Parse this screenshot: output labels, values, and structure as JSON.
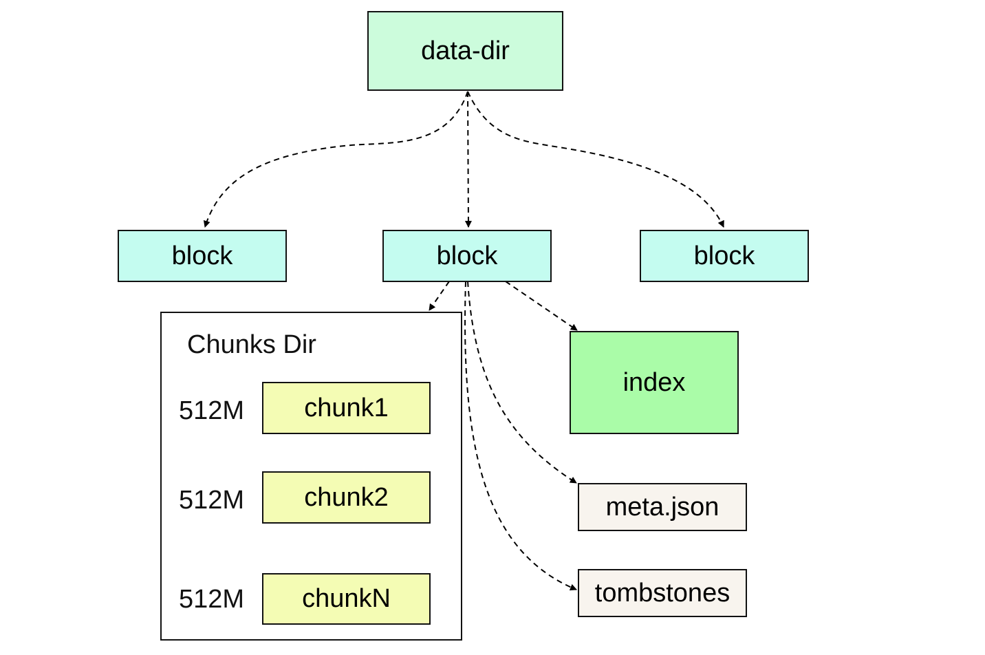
{
  "nodes": {
    "data_dir": {
      "label": "data-dir",
      "color": "#ccfcdc"
    },
    "block_left": {
      "label": "block",
      "color": "#c4fcf0"
    },
    "block_center": {
      "label": "block",
      "color": "#c4fcf0"
    },
    "block_right": {
      "label": "block",
      "color": "#c4fcf0"
    },
    "index": {
      "label": "index",
      "color": "#aafca8"
    },
    "meta_json": {
      "label": "meta.json",
      "color": "#f8f4ee"
    },
    "tombstones": {
      "label": "tombstones",
      "color": "#f8f4ee"
    }
  },
  "chunks_dir": {
    "title": "Chunks Dir",
    "chunks": [
      {
        "label": "chunk1",
        "size": "512M"
      },
      {
        "label": "chunk2",
        "size": "512M"
      },
      {
        "label": "chunkN",
        "size": "512M"
      }
    ],
    "chunk_color": "#f4fcb4"
  }
}
